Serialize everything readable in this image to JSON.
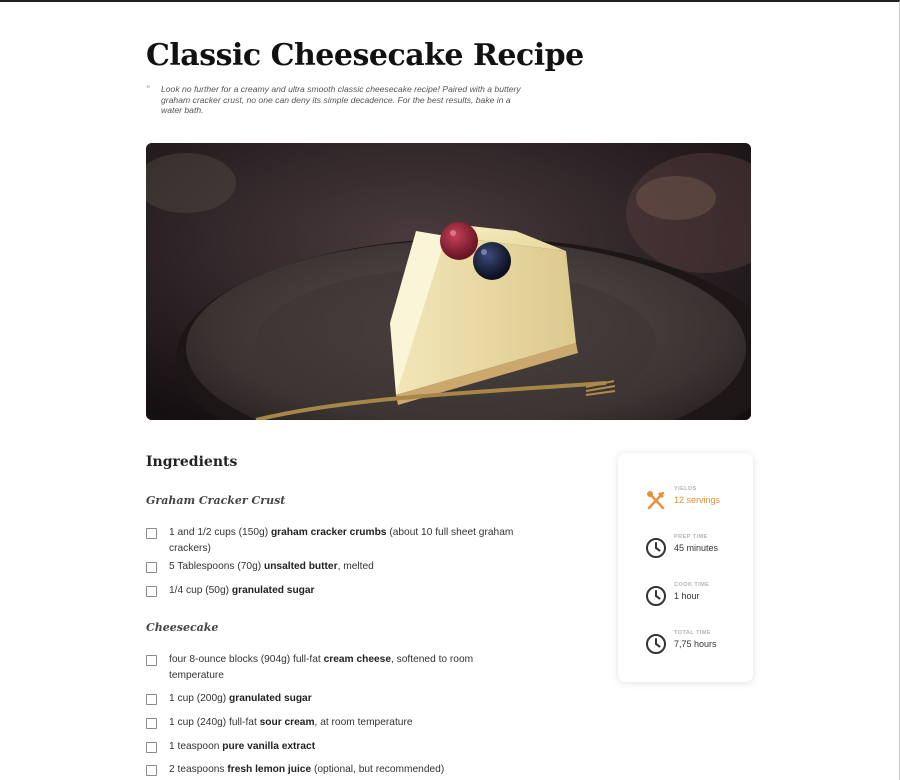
{
  "recipe": {
    "title": "Classic Cheesecake Recipe",
    "intro": "Look no further for a creamy and ultra smooth classic cheesecake recipe! Paired with a buttery graham cracker crust, no one can deny its simple decadence. For the best results, bake in a water bath.",
    "hero_image": "cheesecake-slice-photo"
  },
  "ingredients": {
    "heading": "Ingredients",
    "groups": [
      {
        "title": "Graham Cracker Crust",
        "items": [
          {
            "pre": "1 and 1/2 cups (150g) ",
            "bold": "graham cracker crumbs",
            "post": " (about 10 full sheet graham crackers)"
          },
          {
            "pre": "5 Tablespoons (70g) ",
            "bold": "unsalted butter",
            "post": ", melted"
          },
          {
            "pre": "1/4 cup (50g) ",
            "bold": "granulated sugar",
            "post": ""
          }
        ]
      },
      {
        "title": "Cheesecake",
        "items": [
          {
            "pre": "four 8-ounce blocks (904g) full-fat ",
            "bold": "cream cheese",
            "post": ", softened to room temperature"
          },
          {
            "pre": "1 cup (200g) ",
            "bold": "granulated sugar",
            "post": ""
          },
          {
            "pre": "1 cup (240g) full-fat ",
            "bold": "sour cream",
            "post": ", at room temperature"
          },
          {
            "pre": "1 teaspoon ",
            "bold": "pure vanilla extract",
            "post": ""
          },
          {
            "pre": "2 teaspoons ",
            "bold": "fresh lemon juice",
            "post": " (optional, but recommended)"
          }
        ]
      }
    ]
  },
  "info": {
    "yields": {
      "label": "YIELDS",
      "value": "12 servings",
      "icon": "utensils-icon"
    },
    "prep": {
      "label": "PREP TIME",
      "value": "45 minutes",
      "icon": "clock-icon"
    },
    "cook": {
      "label": "COOK TIME",
      "value": "1 hour",
      "icon": "clock-icon"
    },
    "total": {
      "label": "TOTAL TIME",
      "value": "7,75 hours",
      "icon": "clock-icon"
    }
  },
  "colors": {
    "accent": "#e8913a",
    "text": "#333333"
  }
}
